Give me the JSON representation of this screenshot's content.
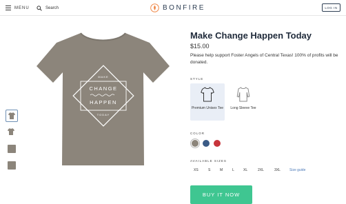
{
  "header": {
    "menu_label": "MENU",
    "search_label": "Search",
    "brand": "BONFIRE",
    "login_label": "LOG IN"
  },
  "product": {
    "title": "Make Change Happen Today",
    "price": "$15.00",
    "description": "Please help support Foster Angels of Central Texas! 100% of profits will be donated.",
    "design_lines": [
      "MAKE",
      "CHANGE",
      "HAPPEN",
      "TODAY"
    ]
  },
  "style": {
    "label": "STYLE",
    "options": [
      {
        "name": "Premium Unisex Tee",
        "selected": true
      },
      {
        "name": "Long Sleeve Tee",
        "selected": false
      }
    ]
  },
  "color": {
    "label": "COLOR",
    "swatches": [
      "#8c857b",
      "#3b5b86",
      "#c7343b"
    ],
    "selected_index": 0
  },
  "sizes": {
    "label": "AVAILABLE SIZES",
    "options": [
      "XS",
      "S",
      "M",
      "L",
      "XL",
      "2XL",
      "3XL"
    ],
    "guide_label": "Size guide"
  },
  "cta": {
    "label": "BUY IT NOW",
    "color": "#3fc691"
  },
  "icons": [
    "hamburger-icon",
    "search-icon",
    "bonfire-logo-icon",
    "tshirt-icon",
    "long-sleeve-icon"
  ]
}
